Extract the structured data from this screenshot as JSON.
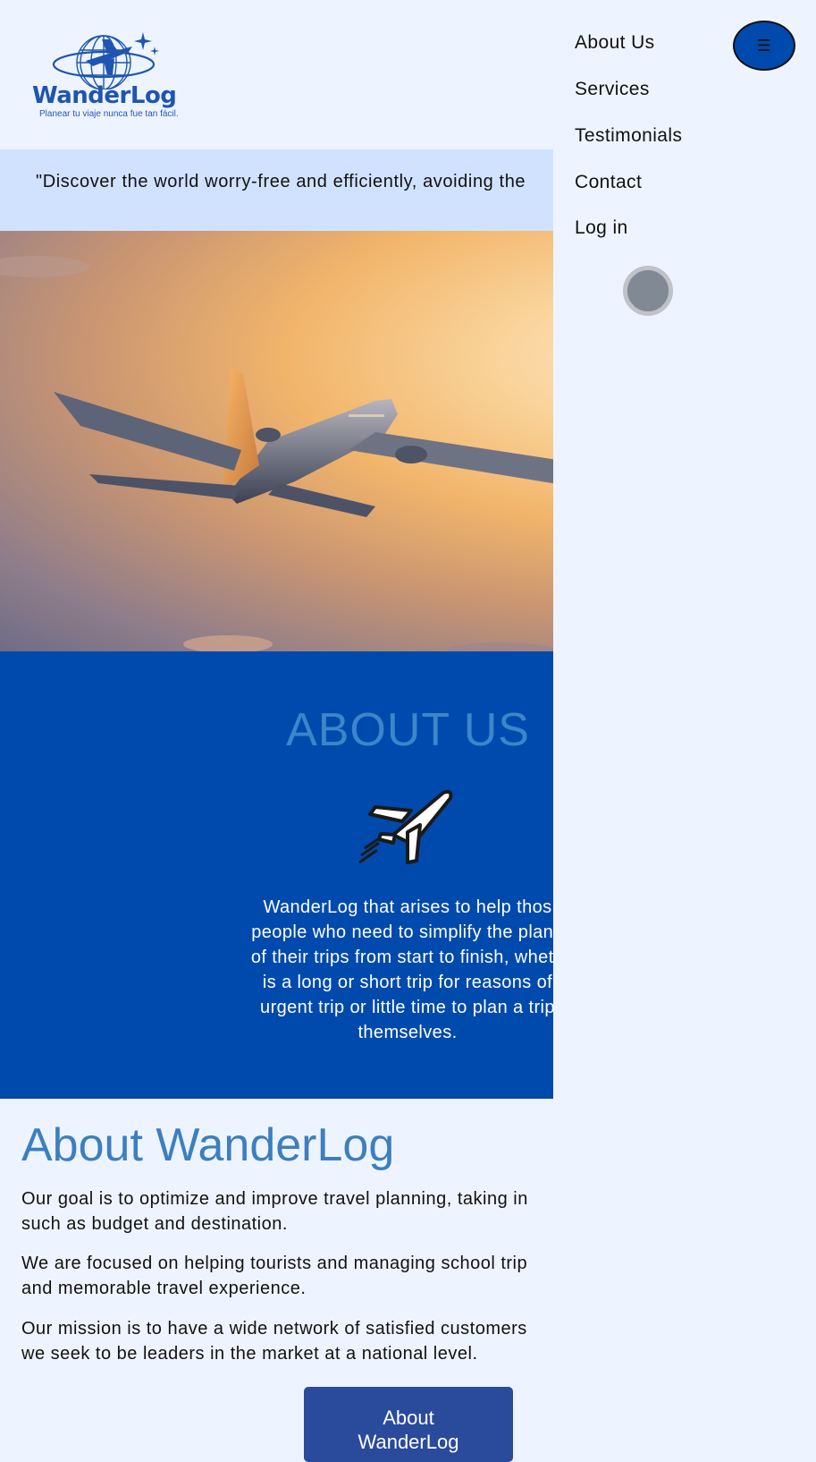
{
  "brand": {
    "name": "WanderLog",
    "tagline": "Planear tu viaje nunca fue tan fácil."
  },
  "quote": "\"Discover the world worry-free and efficiently, avoiding the",
  "hero": {
    "image": "airplane-sunset-photo"
  },
  "about_us": {
    "title": "ABOUT US",
    "icon": "airplane-icon",
    "text_lines": [
      "WanderLog that arises to help thos",
      "people who need to simplify the plann",
      "of their trips from start to finish, wheth",
      "is a long or short trip for reasons of",
      "urgent trip or little time to plan a trip",
      "themselves."
    ]
  },
  "about_wanderlog": {
    "title": "About WanderLog",
    "paragraphs": [
      [
        "Our goal is to optimize and improve travel planning, taking in",
        "such as budget and destination."
      ],
      [
        "We are focused on helping tourists and managing school trip",
        "and memorable travel experience."
      ],
      [
        "Our mission is to have a wide network of satisfied customers",
        "we seek to be leaders in the market at a national level."
      ]
    ],
    "button_lines": [
      "About",
      "WanderLog"
    ]
  },
  "menu": {
    "items": [
      "About Us",
      "Services",
      "Testimonials",
      "Contact",
      "Log in"
    ],
    "toggle_icon": "☰"
  },
  "colors": {
    "page_bg": "#eef4ff",
    "quote_band": "#d0e2ff",
    "about_band": "#004aad",
    "about_title": "#3c86c9",
    "heading": "#3c7fc0",
    "button": "#2a4a9c"
  }
}
